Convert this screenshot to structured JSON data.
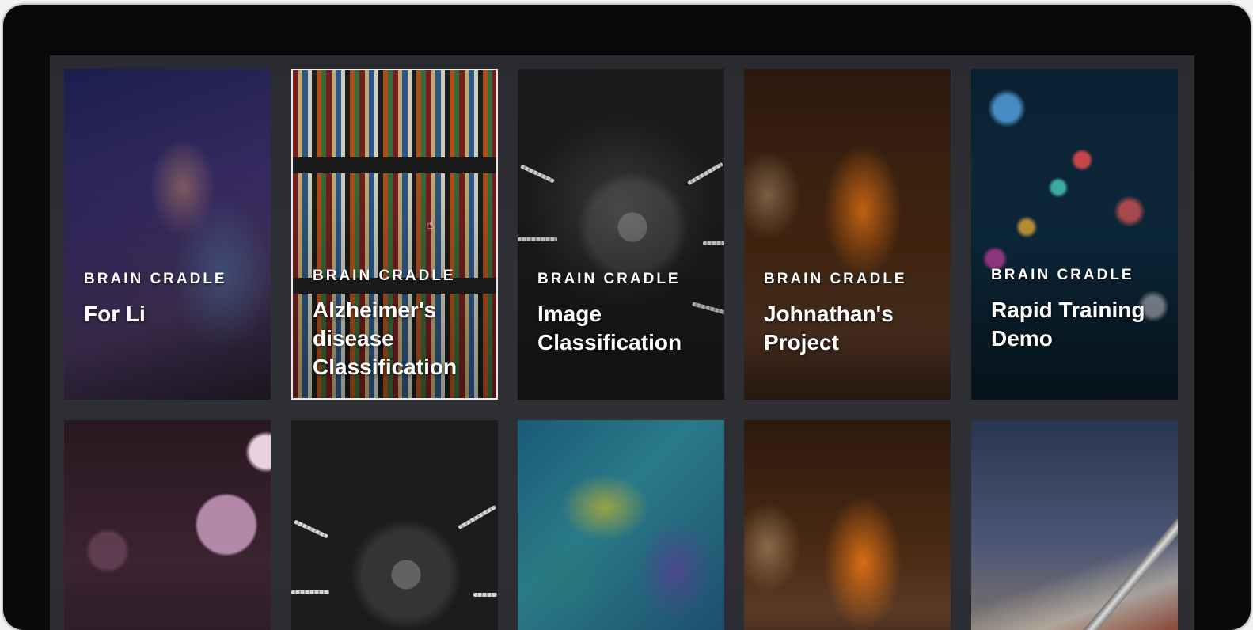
{
  "gallery": {
    "cards": [
      {
        "brand": "BRAIN CRADLE",
        "title": "For Li"
      },
      {
        "brand": "BRAIN CRADLE",
        "title": "Alzheimer's disease Classification"
      },
      {
        "brand": "BRAIN CRADLE",
        "title": "Image Classification"
      },
      {
        "brand": "BRAIN CRADLE",
        "title": "Johnathan's Project"
      },
      {
        "brand": "BRAIN CRADLE",
        "title": "Rapid Training Demo"
      }
    ]
  },
  "icons": {
    "cursor": "pointer-hand-icon"
  },
  "colors": {
    "device_bezel": "#080a0a",
    "screen_bg": "#2d2e33",
    "selected_border": "#e9e9e9",
    "text": "#ffffff"
  }
}
